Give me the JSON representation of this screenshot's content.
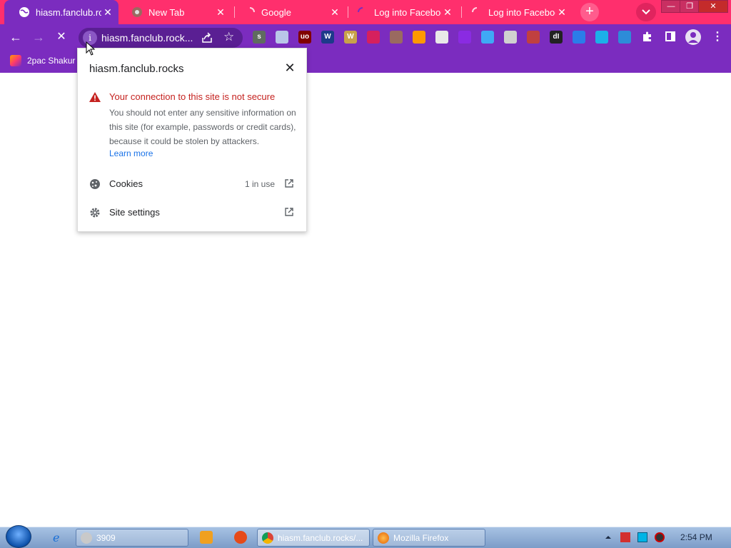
{
  "tabs": [
    {
      "title": "hiasm.fanclub.rocks/",
      "active": true
    },
    {
      "title": "New Tab",
      "active": false
    },
    {
      "title": "Google",
      "active": false
    },
    {
      "title": "Log into Facebook",
      "active": false
    },
    {
      "title": "Log into Facebook",
      "active": false
    }
  ],
  "window_controls": {
    "minimize": "—",
    "restore": "❐",
    "close": "✕"
  },
  "toolbar": {
    "url": "hiasm.fanclub.rock...",
    "info_glyph": "i",
    "back_glyph": "←",
    "forward_glyph": "→",
    "stop_glyph": "✕",
    "newtab_glyph": "+",
    "extensions": [
      {
        "name": "s",
        "color": "#5f6b5f"
      },
      {
        "name": "",
        "color": "#b9c6e8"
      },
      {
        "name": "uo",
        "color": "#800000"
      },
      {
        "name": "W",
        "color": "#1d3a8a"
      },
      {
        "name": "W",
        "color": "#c8a24a"
      },
      {
        "name": "",
        "color": "#d6205e"
      },
      {
        "name": "",
        "color": "#9a6a60"
      },
      {
        "name": "",
        "color": "#ff9900"
      },
      {
        "name": "",
        "color": "#e8e8e8"
      },
      {
        "name": "",
        "color": "#8a2be2"
      },
      {
        "name": "",
        "color": "#3fa9f5"
      },
      {
        "name": "",
        "color": "#d0d0d0"
      },
      {
        "name": "",
        "color": "#c04040"
      },
      {
        "name": "dI",
        "color": "#222222"
      },
      {
        "name": "",
        "color": "#2b7de9"
      },
      {
        "name": "",
        "color": "#1cb0e8"
      },
      {
        "name": "",
        "color": "#2d8cd8"
      }
    ]
  },
  "bookmarks": [
    {
      "label": "2pac Shakur -"
    }
  ],
  "popup": {
    "host": "hiasm.fanclub.rocks",
    "warning_title": "Your connection to this site is not secure",
    "warning_body": "You should not enter any sensitive information on this site (for example, passwords or credit cards), because it could be stolen by attackers.",
    "learn_more": "Learn more",
    "rows": [
      {
        "label": "Cookies",
        "meta": "1 in use",
        "icon": "cookie-icon"
      },
      {
        "label": "Site settings",
        "meta": "",
        "icon": "gear-icon"
      }
    ]
  },
  "taskbar": {
    "buttons": [
      {
        "label": "3909"
      },
      {
        "label": "hiasm.fanclub.rocks/..."
      },
      {
        "label": "Mozilla Firefox"
      }
    ],
    "clock": "2:54 PM"
  },
  "colors": {
    "tabstrip": "#ff2f6d",
    "toolbar": "#7b2cbf",
    "warning": "#c5221f",
    "link": "#1a73e8"
  }
}
